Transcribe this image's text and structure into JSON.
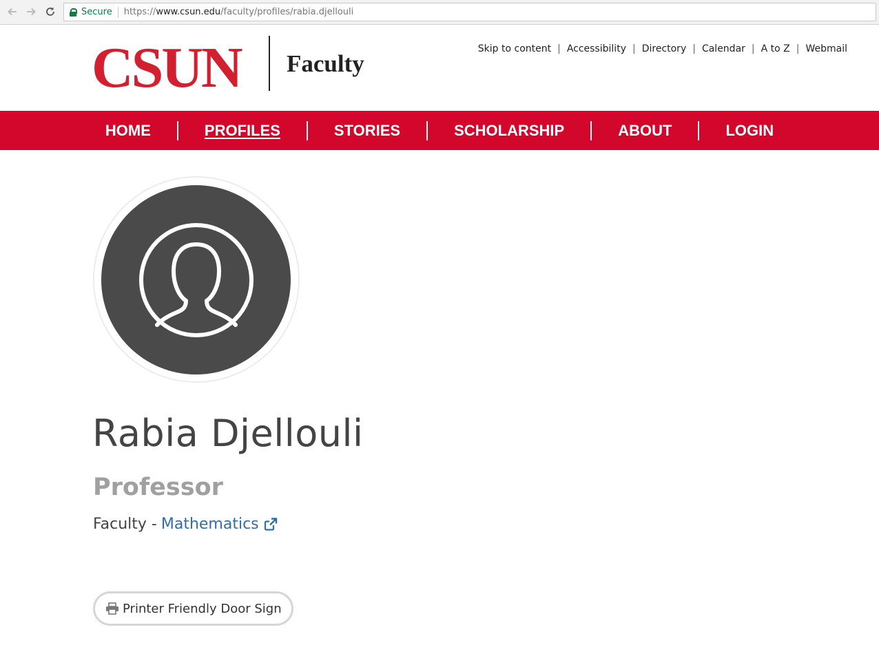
{
  "browser": {
    "security_label": "Secure",
    "url_scheme": "https://",
    "url_host": "www.csun.edu",
    "url_path": "/faculty/profiles/rabia.djellouli",
    "icons": [
      "back-arrow-icon",
      "forward-arrow-icon",
      "reload-icon",
      "lock-icon"
    ]
  },
  "header": {
    "logo_text": "CSUN",
    "site_name": "Faculty",
    "utility_links": [
      "Skip to content",
      "Accessibility",
      "Directory",
      "Calendar",
      "A to Z",
      "Webmail"
    ],
    "separator": "|"
  },
  "main_nav": {
    "items": [
      "HOME",
      "PROFILES",
      "STORIES",
      "SCHOLARSHIP",
      "ABOUT",
      "LOGIN"
    ],
    "active": "PROFILES"
  },
  "profile": {
    "avatar_icon": "user-silhouette-icon",
    "name": "Rabia Djellouli",
    "title": "Professor",
    "affiliation_prefix": "Faculty -",
    "department": "Mathematics",
    "department_icon": "external-link-icon"
  },
  "actions": {
    "door_sign_label": "Printer Friendly Door Sign",
    "door_sign_icon": "printer-icon"
  },
  "colors": {
    "brand_red": "#d2072b",
    "logo_red": "#d22030",
    "link_blue": "#2f6fa8",
    "secure_green": "#0b8043",
    "avatar_gray": "#4a4a4a"
  }
}
